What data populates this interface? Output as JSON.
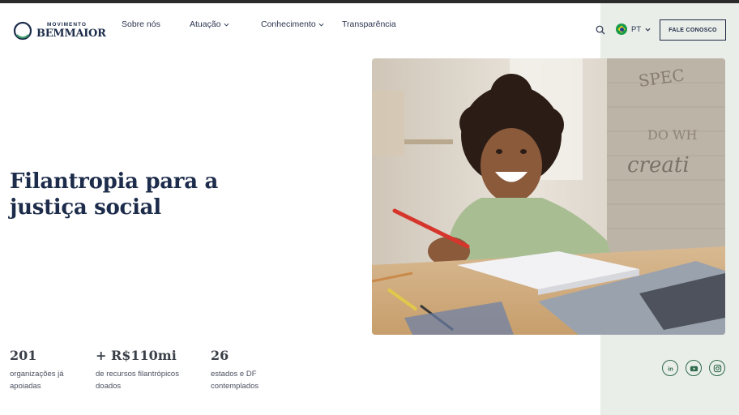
{
  "brand": {
    "name_top": "MOVIMENTO",
    "name_bottom": "BEMMAIOR"
  },
  "nav": {
    "items": [
      {
        "label": "Sobre nós",
        "has_dropdown": false
      },
      {
        "label": "Atuação",
        "has_dropdown": true
      },
      {
        "label": "Conhecimento",
        "has_dropdown": true
      },
      {
        "label": "Transparência",
        "has_dropdown": false
      }
    ],
    "language": "PT",
    "cta_label": "FALE CONOSCO"
  },
  "hero": {
    "title": "Filantropia para a justiça social"
  },
  "stats": [
    {
      "value": "201",
      "label_1": "organizações já",
      "label_2": "apoiadas"
    },
    {
      "value": "+ R$110mi",
      "label_1": "de recursos filantrópicos",
      "label_2": "doados"
    },
    {
      "value": "26",
      "label_1": "estados e DF",
      "label_2": "contemplados"
    }
  ],
  "social": [
    "linkedin-icon",
    "youtube-icon",
    "instagram-icon"
  ],
  "colors": {
    "navy": "#1c2c4a",
    "green_panel": "#e9eee9",
    "brand_green": "#2f6a4a"
  }
}
